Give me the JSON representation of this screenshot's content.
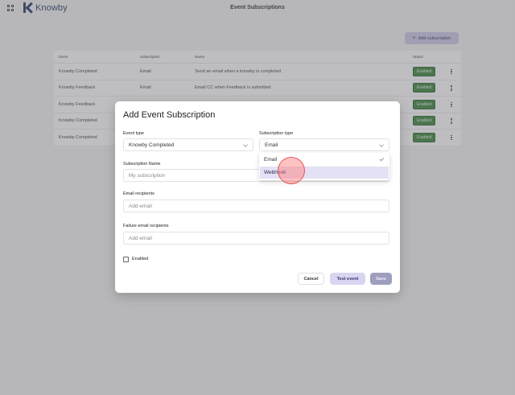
{
  "app": {
    "logo_text": "Knowby",
    "page_title": "Event Subscriptions"
  },
  "toolbar": {
    "add_label": "Add subscription",
    "add_icon": "plus-icon"
  },
  "table": {
    "headers": [
      "Event",
      "Subscription",
      "Name",
      "Status"
    ],
    "rows": [
      {
        "event": "Knowby Completed",
        "subscription": "Email",
        "name": "Send an email when a knowby is completed",
        "status": "Enabled"
      },
      {
        "event": "Knowby Feedback",
        "subscription": "Email",
        "name": "Email CC when Feedback is submitted",
        "status": "Enabled"
      },
      {
        "event": "Knowby Feedback",
        "subscription": "",
        "name": "",
        "status": "Enabled"
      },
      {
        "event": "Knowby Completed",
        "subscription": "",
        "name": "",
        "status": "Enabled"
      },
      {
        "event": "Knowby Completed",
        "subscription": "",
        "name": "",
        "status": "Enabled"
      }
    ]
  },
  "modal": {
    "title": "Add Event Subscription",
    "event_type_label": "Event type",
    "event_type_value": "Knowby Completed",
    "subscription_type_label": "Subscription type",
    "subscription_type_value": "Email",
    "subscription_name_label": "Subscription Name",
    "subscription_name_placeholder": "My subscription",
    "email_recipients_label": "Email recipients",
    "email_recipients_placeholder": "Add email",
    "failure_recipients_label": "Failure email recipients",
    "failure_recipients_placeholder": "Add email",
    "enabled_label": "Enabled",
    "cancel_label": "Cancel",
    "test_label": "Test event",
    "save_label": "Save"
  },
  "dropdown": {
    "options": [
      "Email",
      "Webhook"
    ],
    "selected": "Email",
    "highlighted": "Webhook"
  },
  "colors": {
    "enabled_badge": "#2e7d32",
    "accent": "#c9c5e8"
  }
}
